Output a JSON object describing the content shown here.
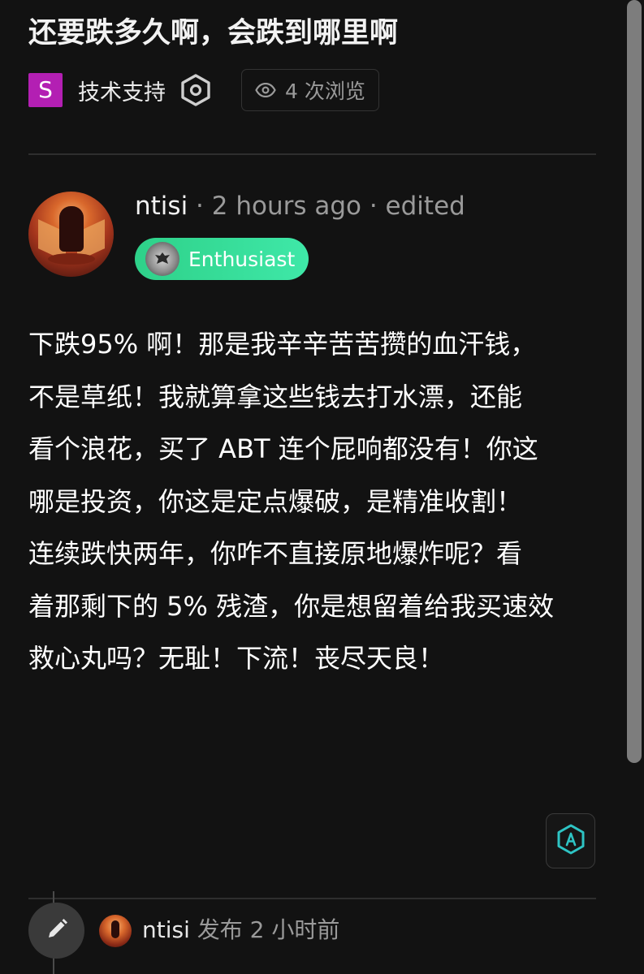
{
  "topic": {
    "title": "还要跌多久啊，会跌到哪里啊",
    "category_letter": "S",
    "category_color": "#b31fb3",
    "category_label": "技术支持",
    "views_label": "4 次浏览"
  },
  "post": {
    "author": "ntisi",
    "separator1": " · ",
    "time_ago": "2 hours ago",
    "separator2": "  ·  ",
    "edited_label": "edited",
    "badge_label": "Enthusiast",
    "badge_color": "#2ed189",
    "body_lines": [
      "下跌95% 啊！那是我辛辛苦苦攒的血汗钱，",
      "不是草纸！我就算拿这些钱去打水漂，还能",
      "看个浪花，买了 ABT 连个屁响都没有！你这",
      "哪是投资，你这是定点爆破，是精准收割！",
      "连续跌快两年，你咋不直接原地爆炸呢？看",
      "着那剩下的 5% 残渣，你是想留着给我买速效",
      "救心丸吗？无耻！下流！丧尽天良！"
    ]
  },
  "footer": {
    "author": "ntisi",
    "posted_label": " 发布 2 小时前"
  },
  "icons": {
    "category": "category-square",
    "watch": "hexagon-settings-icon",
    "views": "eye-icon",
    "ai": "ai-hexagon-icon",
    "edit": "pencil-icon"
  },
  "colors": {
    "background": "#121212",
    "accent_ai": "#2ec4c4",
    "muted_text": "#9a9a9a"
  }
}
